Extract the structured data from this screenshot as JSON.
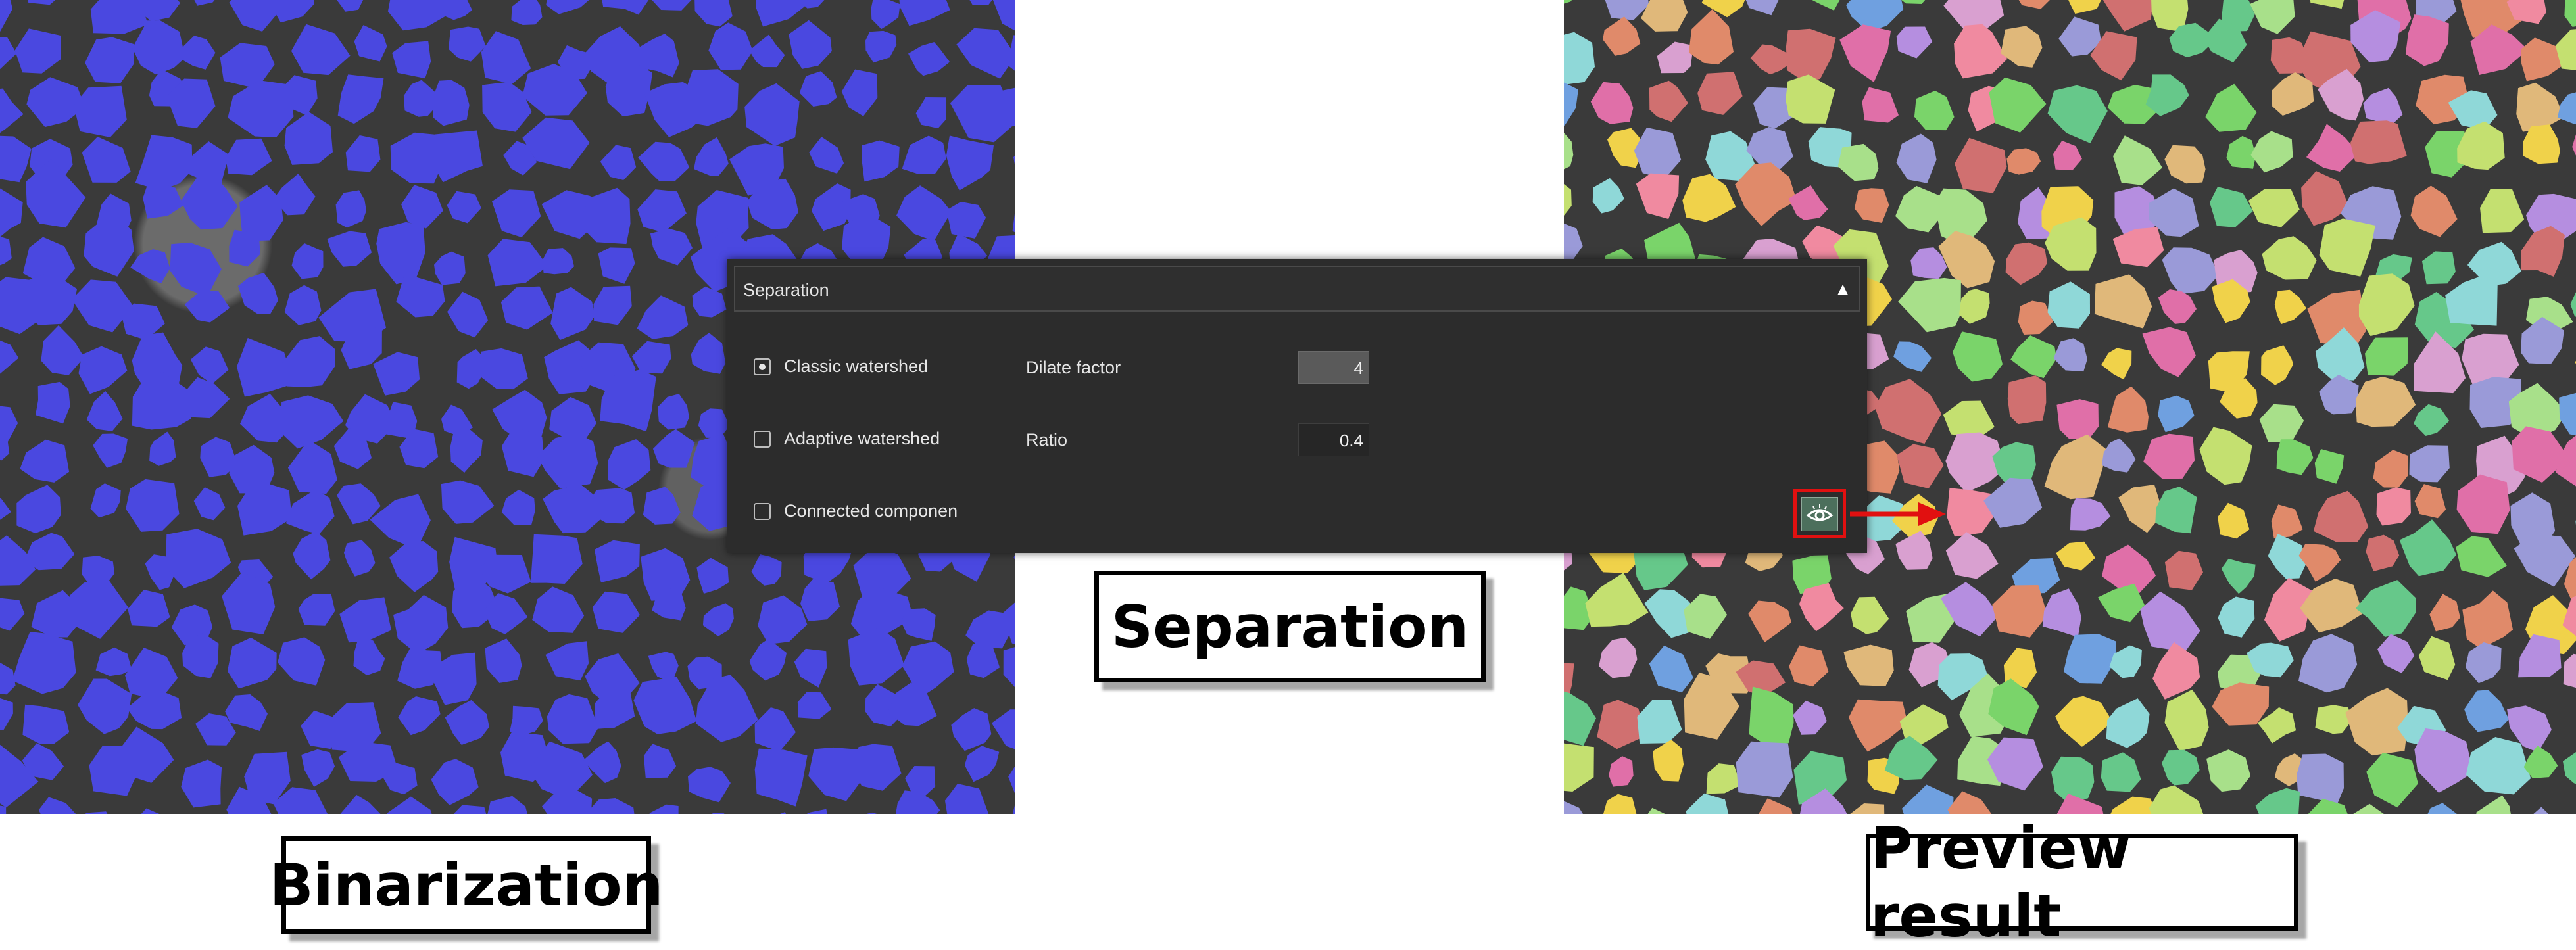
{
  "panel": {
    "title": "Separation",
    "options": [
      {
        "label": "Classic watershed",
        "checked": true
      },
      {
        "label": "Adaptive watershed",
        "checked": false
      },
      {
        "label": "Connected componen",
        "checked": false
      }
    ],
    "params": {
      "dilate_factor": {
        "label": "Dilate factor",
        "value": "4"
      },
      "ratio": {
        "label": "Ratio",
        "value": "0.4"
      }
    },
    "preview_button_icon": "eye-icon",
    "collapse_icon": "triangle-up-icon"
  },
  "captions": {
    "binarization": "Binarization",
    "separation": "Separation",
    "preview": "Preview result"
  },
  "colors": {
    "binarization_overlay": "#4a48e0",
    "panel_background": "#2c2c2c",
    "highlight": "#e11010"
  }
}
